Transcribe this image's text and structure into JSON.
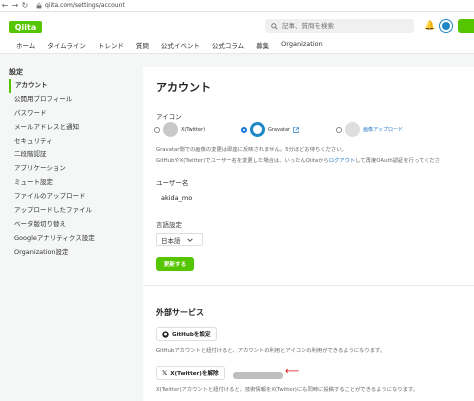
{
  "browser": {
    "back_icon": "←",
    "forward_icon": "→",
    "reload_icon": "↻",
    "url": "qiita.com/settings/account"
  },
  "header": {
    "logo": "Qiita",
    "search_placeholder": "記事、質問を検索",
    "nav": [
      "ホーム",
      "タイムライン",
      "トレンド",
      "質問",
      "公式イベント",
      "公式コラム",
      "募集",
      "Organization"
    ]
  },
  "sidebar": {
    "title": "設定",
    "items": [
      {
        "label": "アカウント",
        "active": true
      },
      {
        "label": "公開用プロフィール",
        "active": false
      },
      {
        "label": "パスワード",
        "active": false
      },
      {
        "label": "メールアドレスと通知",
        "active": false
      },
      {
        "label": "セキュリティ",
        "active": false
      },
      {
        "label": "二段階認証",
        "active": false
      },
      {
        "label": "アプリケーション",
        "active": false
      },
      {
        "label": "ミュート設定",
        "active": false
      },
      {
        "label": "ファイルのアップロード",
        "active": false
      },
      {
        "label": "アップロードしたファイル",
        "active": false
      },
      {
        "label": "ベータ版切り替え",
        "active": false
      },
      {
        "label": "Googleアナリティクス設定",
        "active": false
      },
      {
        "label": "Organization設定",
        "active": false
      }
    ]
  },
  "account": {
    "title": "アカウント",
    "icon_label": "アイコン",
    "icon_options": [
      {
        "label": "X(Twitter)",
        "checked": false
      },
      {
        "label": "Gravatar",
        "checked": true
      },
      {
        "label": "画像アップロード",
        "checked": false
      }
    ],
    "note1": "Gravatar側での画像の変更は即座に反映されません。5分ほどお待ちください。",
    "note2_pre": "GitHubやX(Twitter)でユーザー名を変更した場合は、いったんQiitaから",
    "note2_link": "ログアウト",
    "note2_post": "して再度OAuth認証を行ってくださ",
    "username_label": "ユーザー名",
    "username_value": "akida_mo",
    "language_label": "言語設定",
    "language_value": "日本語",
    "save_label": "更新する"
  },
  "external": {
    "title": "外部サービス",
    "github_button": "GitHubを設定",
    "github_note": "GitHubアカウントと紐付けると、アカウントの利用とアイコンの利用ができるようになります。",
    "x_button": "X(Twitter)を解除",
    "x_note": "X(Twitter)アカウントと紐付けると、技術情報をX(Twitter)にも同時に投稿することができるようになります。"
  },
  "colors": {
    "brand": "#55c500",
    "link": "#1a73c9",
    "annotation_arrow": "#e01010"
  }
}
